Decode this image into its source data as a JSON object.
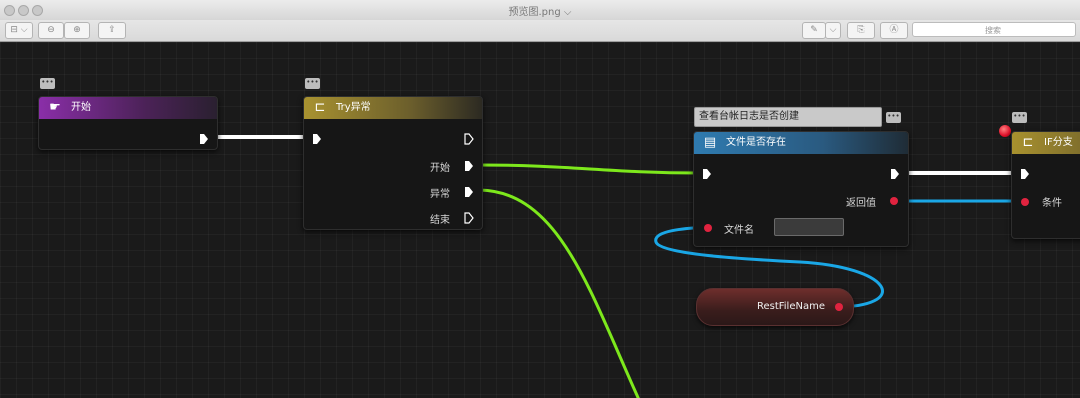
{
  "window": {
    "title": "预览图.png ⌵",
    "search_placeholder": "搜索"
  },
  "toolbar": {
    "sidebar": "⊟ ⌵",
    "zoom_out": "⊖",
    "zoom_in": "⊕",
    "share": "⇪",
    "markup": "✎",
    "markup_menu": "⌵",
    "rotate": "⎘",
    "annotate": "Ⓐ"
  },
  "nodes": {
    "start": {
      "title": "开始",
      "icon": "hand-pointing-icon"
    },
    "try": {
      "title": "Try异常",
      "icon": "try-bracket-icon",
      "pins": {
        "start": "开始",
        "exception": "异常",
        "end": "结束"
      }
    },
    "file_exists": {
      "comment": "查看台帐日志是否创建",
      "title": "文件是否存在",
      "icon": "document-icon",
      "pins": {
        "return": "返回值",
        "filename": "文件名"
      }
    },
    "if_branch": {
      "title": "IF分支",
      "icon": "branch-icon",
      "pins": {
        "condition": "条件"
      }
    },
    "var": {
      "label": "RestFileName"
    }
  },
  "colors": {
    "exec_wire": "#ffffff",
    "green_wire": "#7de81c",
    "blue_wire": "#1aa7e6",
    "start_header": "#8a2ea8",
    "try_header": "#a89230",
    "file_header": "#2f7bb0",
    "if_header": "#a8912e"
  }
}
